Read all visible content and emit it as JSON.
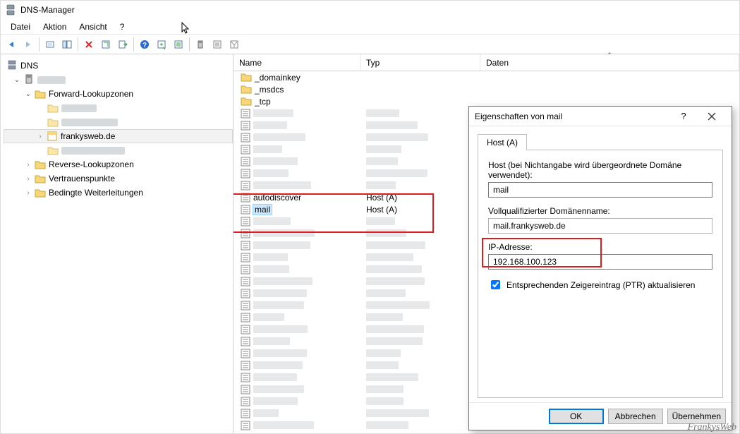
{
  "window": {
    "title": "DNS-Manager"
  },
  "menu": {
    "file": "Datei",
    "action": "Aktion",
    "view": "Ansicht",
    "help": "?"
  },
  "tree": {
    "root": "DNS",
    "server_blur": "████",
    "fwd": "Forward-Lookupzonen",
    "fwd_child1_blur": "████████",
    "fwd_child2_blur": "███████████",
    "selected_zone": "frankysweb.de",
    "fwd_child4_blur": "████████████",
    "rev": "Reverse-Lookupzonen",
    "trust": "Vertrauenspunkte",
    "cond": "Bedingte Weiterleitungen"
  },
  "columns": {
    "name": "Name",
    "type": "Typ",
    "data": "Daten"
  },
  "records": {
    "folders": [
      "_domainkey",
      "_msdcs",
      "_tcp"
    ],
    "auto": "autodiscover",
    "mail": "mail",
    "hostA": "Host (A)"
  },
  "dialog": {
    "title": "Eigenschaften von mail",
    "tab": "Host (A)",
    "host_label": "Host (bei Nichtangabe wird übergeordnete Domäne verwendet):",
    "host_value": "mail",
    "fqdn_label": "Vollqualifizierter Domänenname:",
    "fqdn_value": "mail.frankysweb.de",
    "ip_label": "IP-Adresse:",
    "ip_value": "192.168.100.123",
    "ptr_label": "Entsprechenden Zeigereintrag (PTR) aktualisieren",
    "ok": "OK",
    "cancel": "Abbrechen",
    "apply": "Übernehmen",
    "help": "?"
  },
  "watermark": "FrankysWeb"
}
